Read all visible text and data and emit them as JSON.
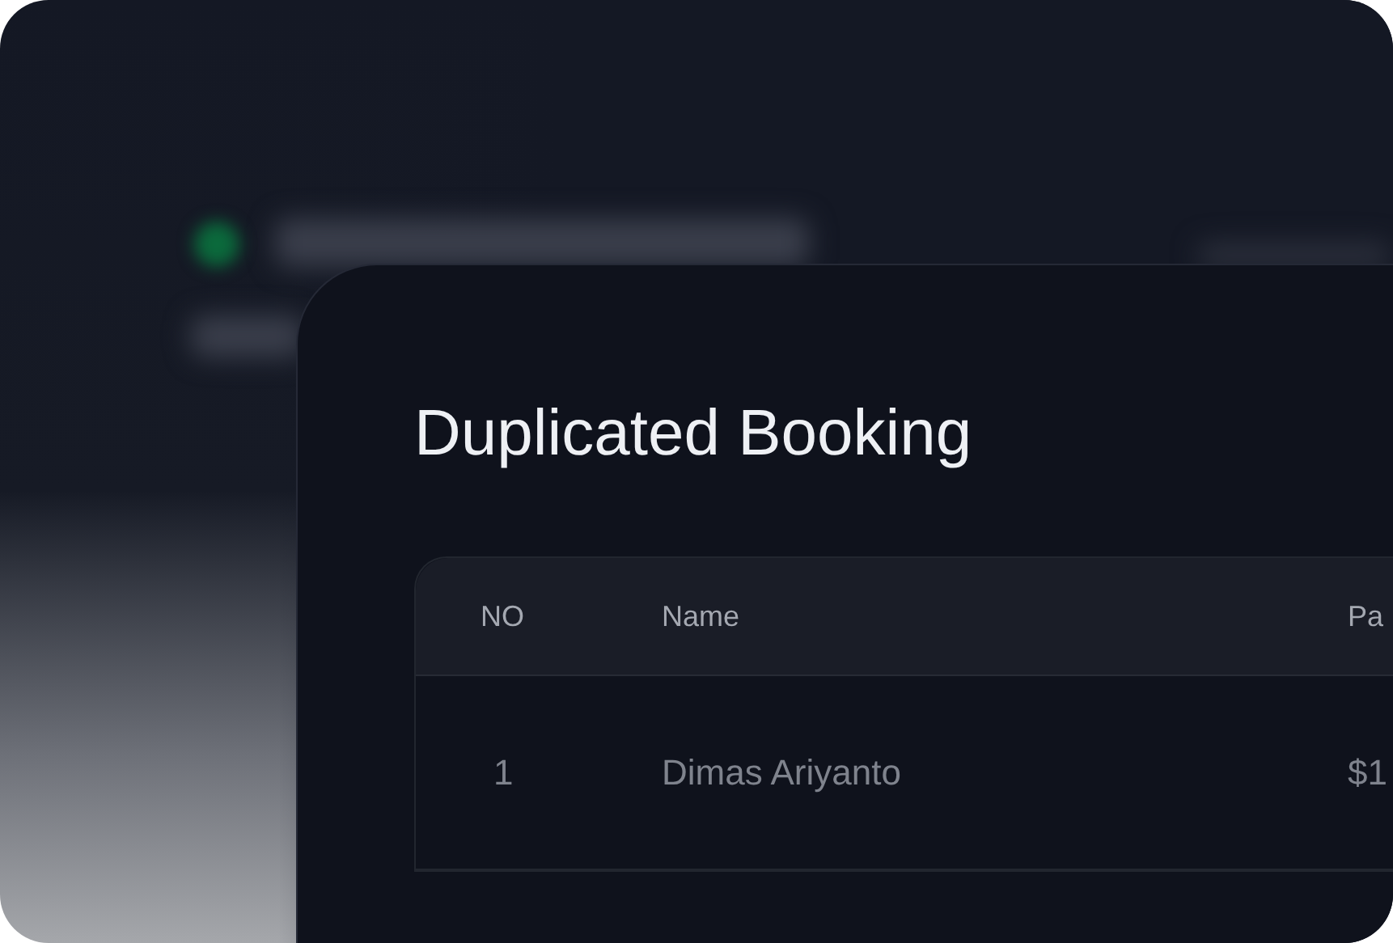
{
  "card": {
    "title": "Duplicated Booking"
  },
  "table": {
    "columns": [
      "NO",
      "Name",
      "Pa"
    ],
    "rows": [
      {
        "cells": [
          "1",
          "Dimas Ariyanto",
          "$1"
        ]
      }
    ]
  }
}
